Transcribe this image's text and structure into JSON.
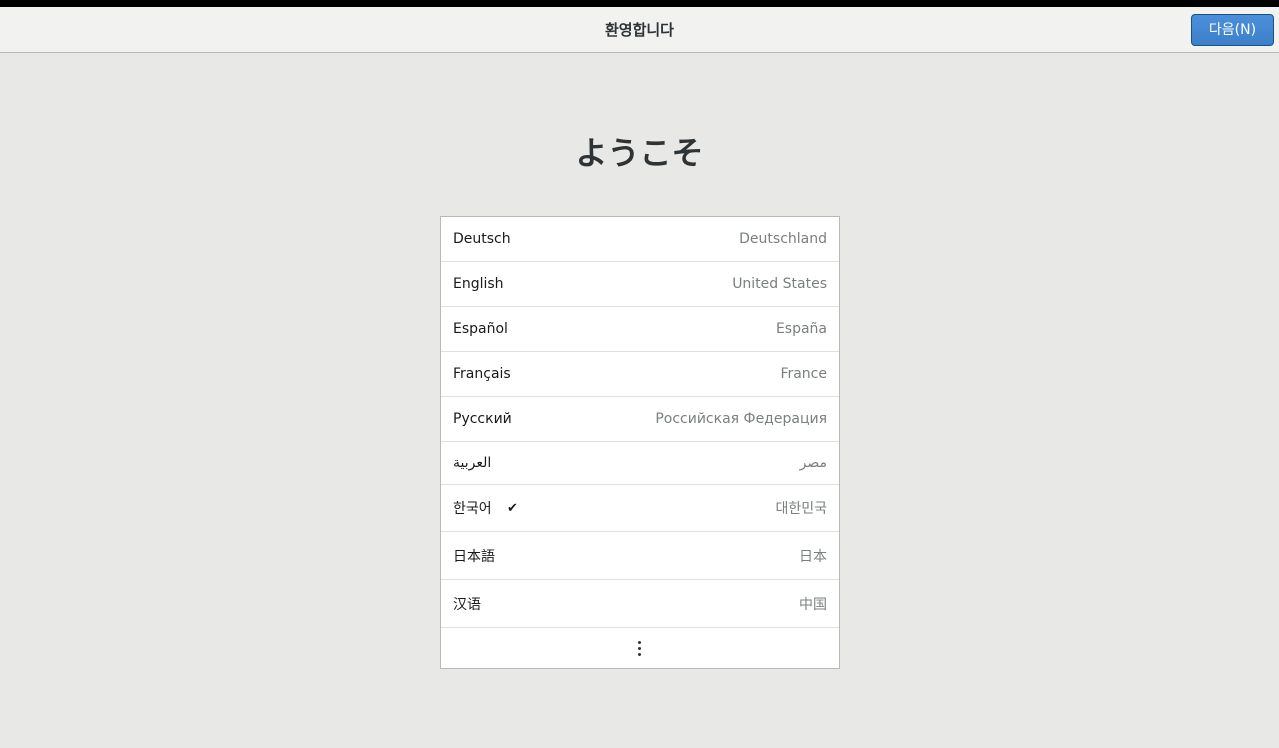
{
  "header": {
    "title": "환영합니다",
    "next_label": "다음(N)"
  },
  "welcome": "ようこそ",
  "languages": [
    {
      "name": "Deutsch",
      "region": "Deutschland"
    },
    {
      "name": "English",
      "region": "United States"
    },
    {
      "name": "Español",
      "region": "España"
    },
    {
      "name": "Français",
      "region": "France"
    },
    {
      "name": "Русский",
      "region": "Российская Федерация"
    },
    {
      "name": "العربية",
      "region": "مصر"
    },
    {
      "name": "한국어",
      "region": "대한민국",
      "selected": true
    },
    {
      "name": "日本語",
      "region": "日本"
    },
    {
      "name": "汉语",
      "region": "中国"
    }
  ],
  "icons": {
    "selected": "check-icon",
    "more": "vertical-ellipsis-icon"
  },
  "colors": {
    "accent": "#4a90d9",
    "background": "#e8e8e7"
  }
}
